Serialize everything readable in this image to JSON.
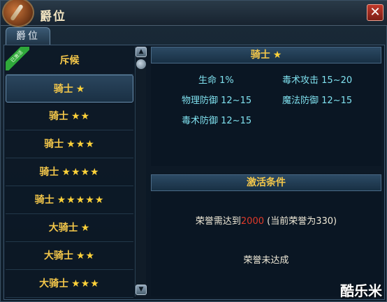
{
  "window": {
    "title": "爵位",
    "close_label": "✕"
  },
  "tabs": [
    {
      "label": "爵位"
    }
  ],
  "ribbon_label": "已激活",
  "ranks": [
    {
      "name": "斥候",
      "stars": ""
    },
    {
      "name": "骑士",
      "stars": "★"
    },
    {
      "name": "骑士",
      "stars": "★★"
    },
    {
      "name": "骑士",
      "stars": "★★★"
    },
    {
      "name": "骑士",
      "stars": "★★★★"
    },
    {
      "name": "骑士",
      "stars": "★★★★★"
    },
    {
      "name": "大骑士",
      "stars": "★"
    },
    {
      "name": "大骑士",
      "stars": "★★"
    },
    {
      "name": "大骑士",
      "stars": "★★★"
    }
  ],
  "selected_index": 1,
  "detail": {
    "title": "骑士",
    "stars": "★",
    "attributes": [
      {
        "label": "生命 1%"
      },
      {
        "label": "毒术攻击 15~20"
      },
      {
        "label": "物理防御 12~15"
      },
      {
        "label": "魔法防御 12~15"
      },
      {
        "label": "毒术防御 12~15"
      }
    ]
  },
  "activation": {
    "header": "激活条件",
    "requirement_prefix": "荣誉需达到",
    "requirement_value": "2000",
    "requirement_suffix": "(当前荣誉为330)",
    "status": "荣誉未达成"
  },
  "scroll": {
    "up_icon": "▲",
    "down_icon": "▼"
  },
  "watermark": "酷乐米",
  "colors": {
    "gold": "#f5c84a",
    "cyan": "#7fe0ee",
    "red": "#e03a2a"
  }
}
